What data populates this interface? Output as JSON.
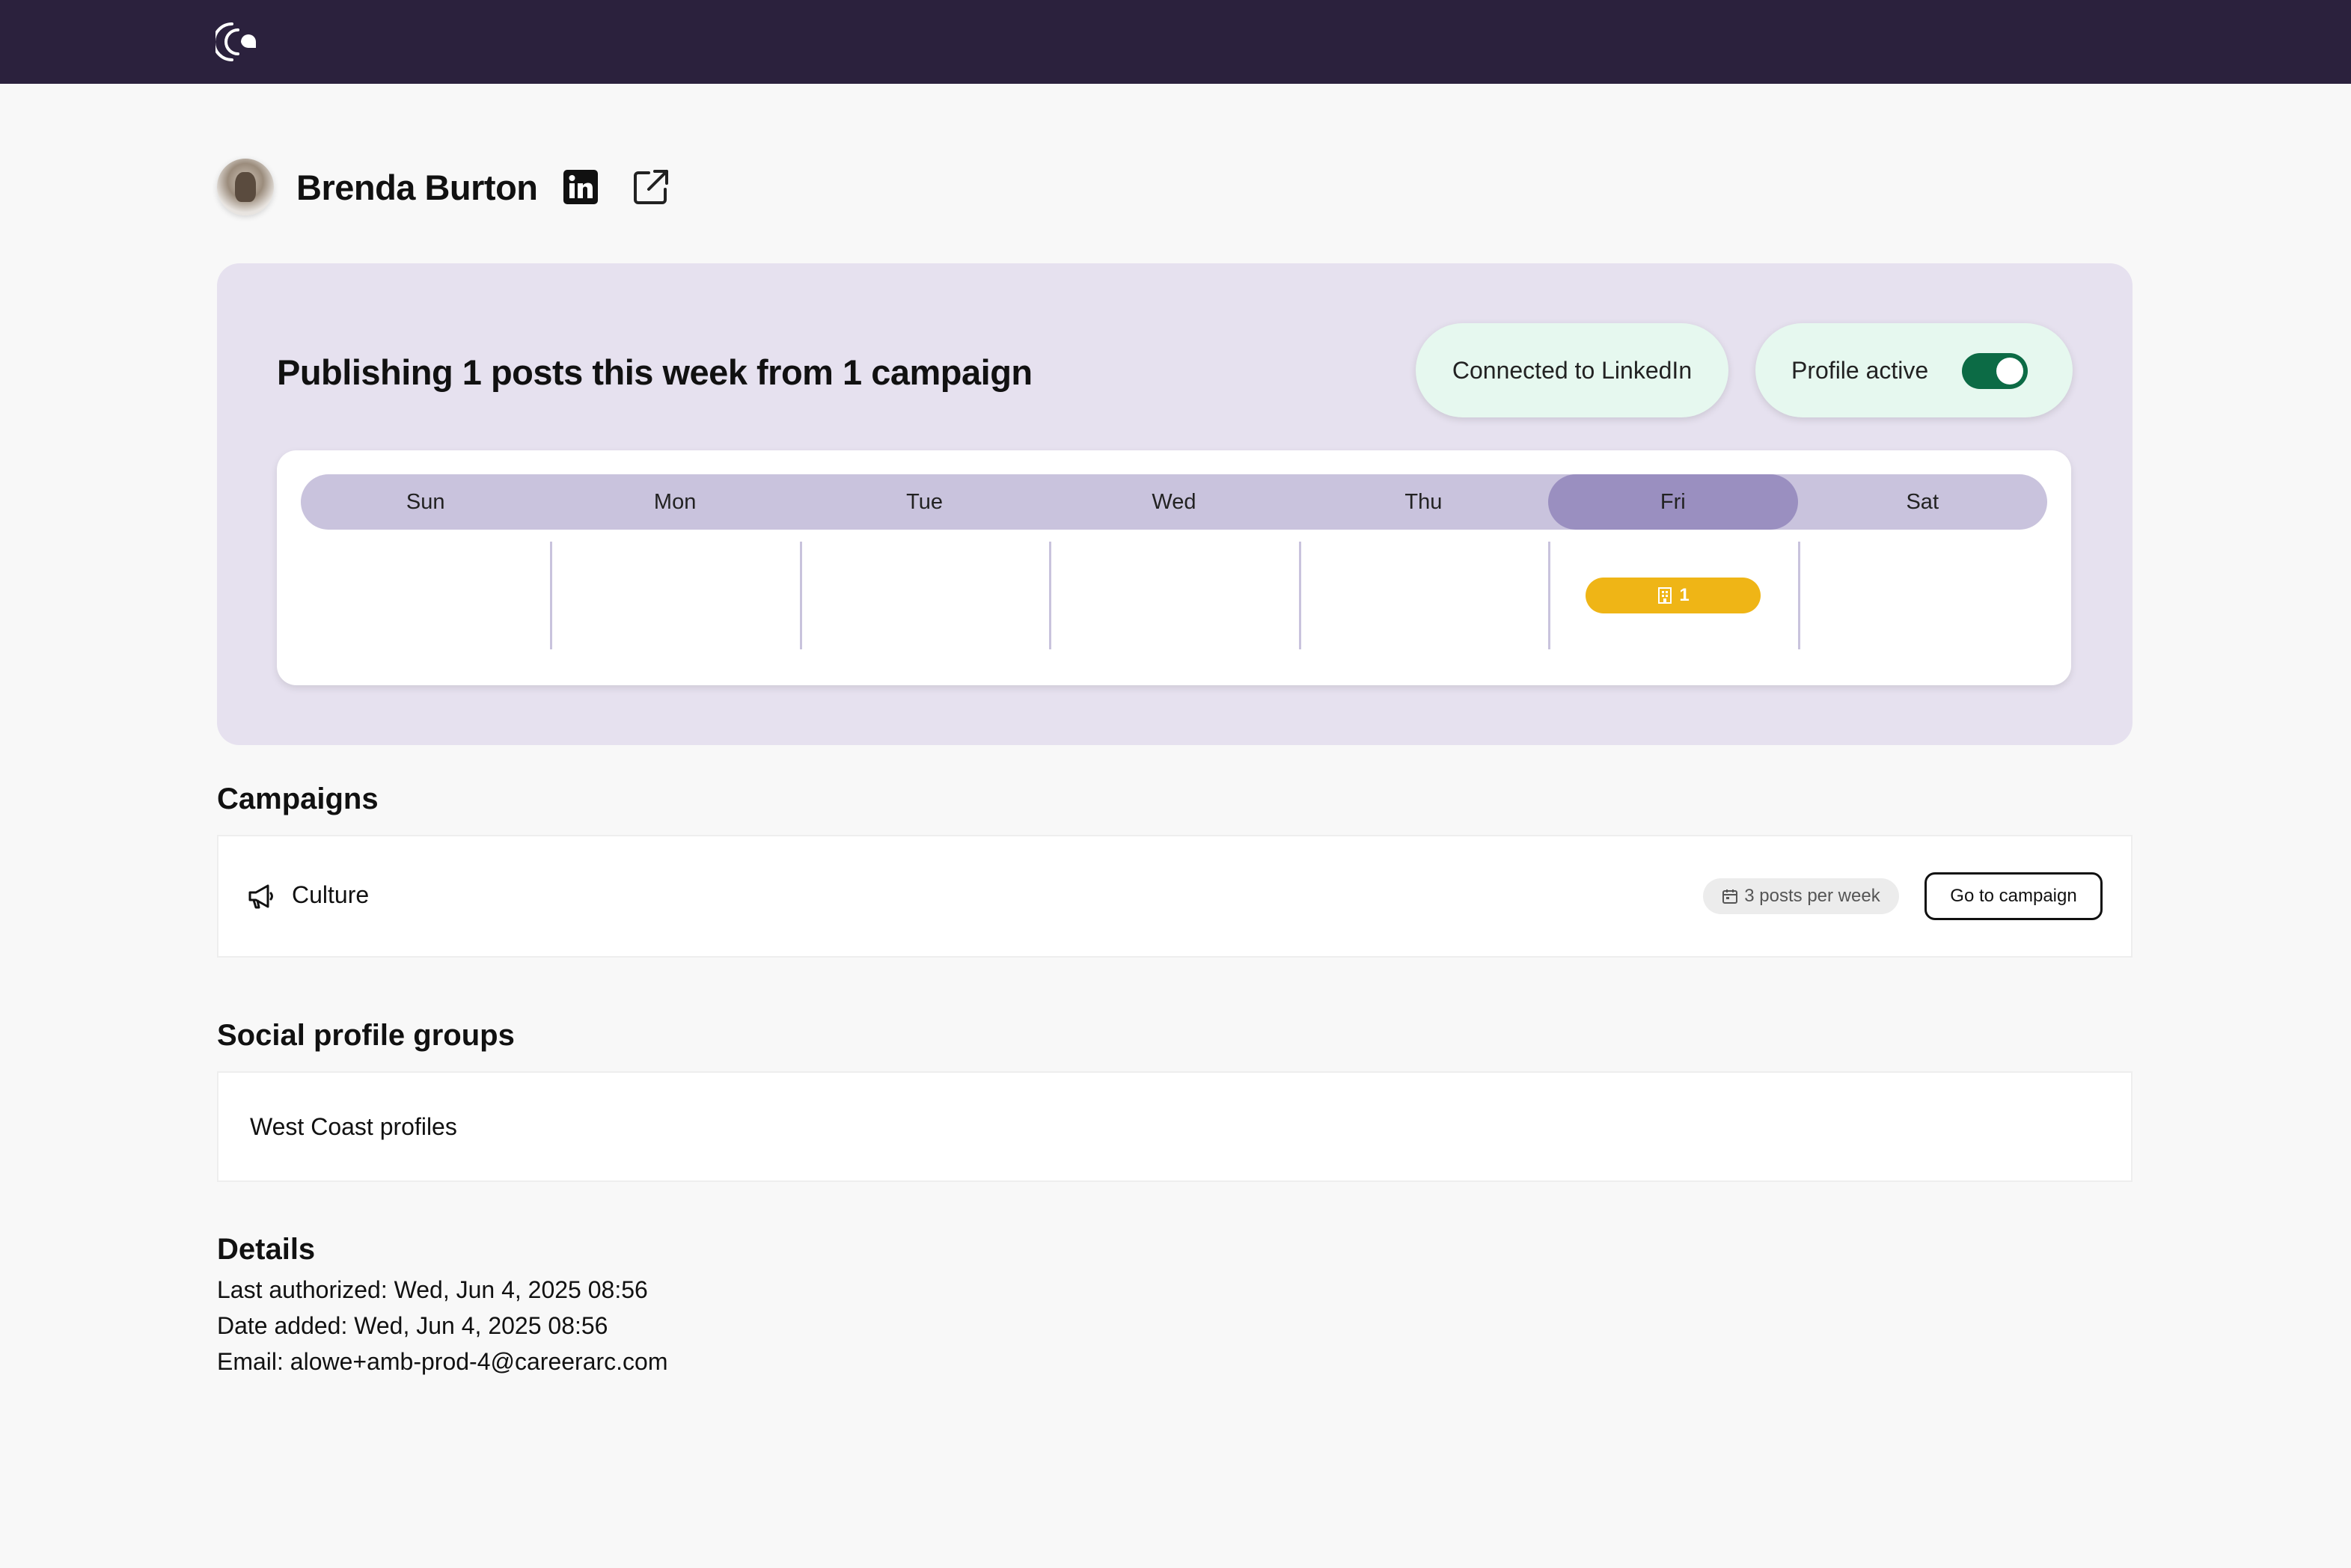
{
  "topbar": {
    "logo_icon": "careerarc-logo-icon"
  },
  "profile": {
    "name": "Brenda Burton",
    "network_icon": "linkedin-icon",
    "external_icon": "external-link-icon"
  },
  "schedule": {
    "title": "Publishing 1 posts this week from 1 campaign",
    "linkedin_status": "Connected to LinkedIn",
    "profile_status_label": "Profile active",
    "profile_active": true,
    "days": [
      "Sun",
      "Mon",
      "Tue",
      "Wed",
      "Thu",
      "Fri",
      "Sat"
    ],
    "current_day": "Fri",
    "posts_by_day": {
      "Fri": "1"
    },
    "post_badge_color": "#efb516"
  },
  "campaigns": {
    "heading": "Campaigns",
    "items": [
      {
        "name": "Culture",
        "frequency": "3 posts per week",
        "action_label": "Go to campaign"
      }
    ]
  },
  "social_groups": {
    "heading": "Social profile groups",
    "items": [
      "West Coast profiles"
    ]
  },
  "details": {
    "heading": "Details",
    "last_authorized": "Last authorized: Wed, Jun 4, 2025 08:56",
    "date_added": "Date added: Wed, Jun 4, 2025 08:56",
    "email": "Email: alowe+amb-prod-4@careerarc.com"
  },
  "colors": {
    "topbar": "#2b213d",
    "panel": "#e6e1ef",
    "toggle_on": "#0c6b45",
    "status_pill": "#e6f8ef"
  }
}
